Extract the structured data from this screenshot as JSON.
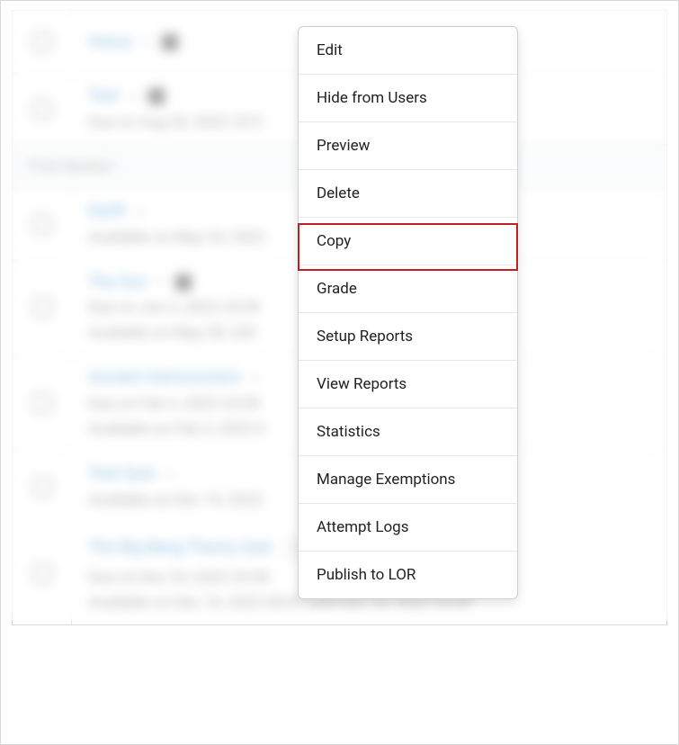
{
  "rows": [
    {
      "title": "Venus",
      "meta1": "",
      "meta2": "",
      "hasIcon": true
    },
    {
      "title": "Test",
      "meta1": "Due on Aug 20, 2022 23:5",
      "meta2": "",
      "hasIcon": true
    },
    {
      "section": "First Section"
    },
    {
      "title": "Earth",
      "meta1": "Available on May 24, 2022",
      "meta2": ""
    },
    {
      "title": "The Sun",
      "meta1": "Due on Jun 3, 2022 23:59",
      "meta2": "Available on May 28, 202",
      "hasIcon": true
    },
    {
      "title": "Ancient Astronomers",
      "meta1": "Due on Feb 3, 2023 23:59",
      "meta2": "Available on Feb 3, 2023 0"
    },
    {
      "title": "Test Quiz",
      "meta1": "Available on Dec 14, 2022",
      "meta2": ""
    }
  ],
  "clear_row": {
    "title": "The Big Bang Theory Quiz",
    "meta1": "Due on Dec 23, 2022 23:59",
    "meta2": "Available on Dec 16, 2022 00:01 until Dec 23, 2022 23:59"
  },
  "menu": {
    "items": [
      "Edit",
      "Hide from Users",
      "Preview",
      "Delete",
      "Copy",
      "Grade",
      "Setup Reports",
      "View Reports",
      "Statistics",
      "Manage Exemptions",
      "Attempt Logs",
      "Publish to LOR"
    ],
    "highlighted_index": 4
  }
}
